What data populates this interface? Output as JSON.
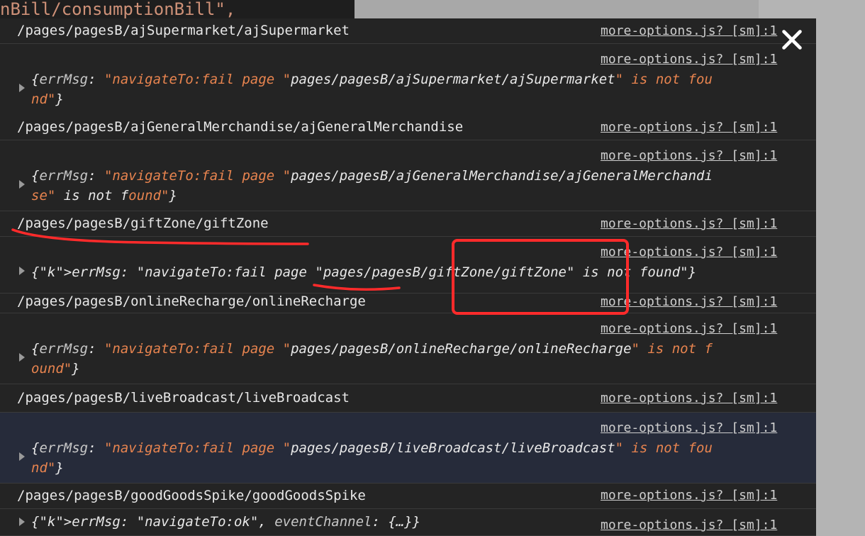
{
  "background": {
    "code_fragment": "nBill/consumptionBill\","
  },
  "close": {
    "icon": "close-icon"
  },
  "entries": [
    {
      "path": "/pages/pagesB/ajSupermarket/ajSupermarket",
      "src1": "more-options.js? [sm]:1",
      "src2": "more-options.js? [sm]:1",
      "err_line1": "{errMsg: \"navigateTo:fail page \"pages/pagesB/ajSupermarket/ajSupermarket\" is not fou",
      "err_line2": "nd\"}"
    },
    {
      "path": "/pages/pagesB/ajGeneralMerchandise/ajGeneralMerchandise",
      "src1": "more-options.js? [sm]:1",
      "src2": "more-options.js? [sm]:1",
      "err_line1": "{errMsg: \"navigateTo:fail page \"pages/pagesB/ajGeneralMerchandise/ajGeneralMerchandi",
      "err_line2": "se\" is not found\"}"
    },
    {
      "path": "/pages/pagesB/giftZone/giftZone",
      "src1": "more-options.js? [sm]:1",
      "src2": "more-options.js? [sm]:1",
      "err_line1": "{errMsg: \"navigateTo:fail page \"pages/pagesB/giftZone/giftZone\" is not found\"}",
      "err_line2": ""
    },
    {
      "path": "/pages/pagesB/onlineRecharge/onlineRecharge",
      "src1": "more-options.js? [sm]:1",
      "src2": "more-options.js? [sm]:1",
      "err_line1": "{errMsg: \"navigateTo:fail page \"pages/pagesB/onlineRecharge/onlineRecharge\" is not f",
      "err_line2": "ound\"}"
    },
    {
      "path": "/pages/pagesB/liveBroadcast/liveBroadcast",
      "src1": "more-options.js? [sm]:1",
      "src2": "more-options.js? [sm]:1",
      "err_line1": "{errMsg: \"navigateTo:fail page \"pages/pagesB/liveBroadcast/liveBroadcast\" is not fou",
      "err_line2": "nd\"}"
    },
    {
      "path": "/pages/pagesB/goodGoodsSpike/goodGoodsSpike",
      "src1": "more-options.js? [sm]:1",
      "src2": "more-options.js? [sm]:1",
      "ok_line": "{errMsg: \"navigateTo:ok\", eventChannel: {…}}"
    }
  ],
  "annotation": {
    "color": "#ff2b2b"
  }
}
